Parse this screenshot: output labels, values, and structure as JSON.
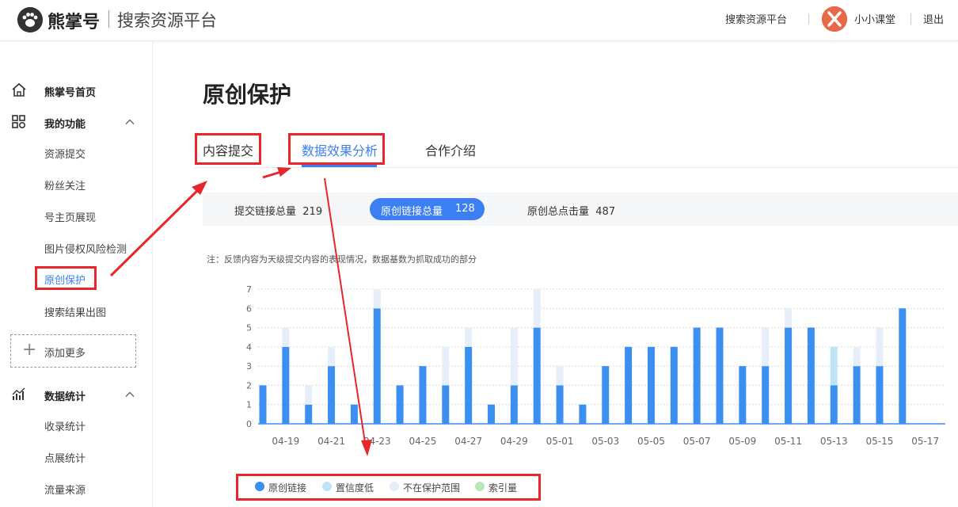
{
  "header": {
    "brand": "熊掌号",
    "subtitle": "搜索资源平台",
    "links": {
      "platform": "搜索资源平台",
      "username": "小小课堂",
      "logout": "退出"
    },
    "logo_icon": "paw-icon",
    "avatar_icon": "avatar-x-icon"
  },
  "sidebar": {
    "home": "熊掌号首页",
    "functions": {
      "title": "我的功能",
      "items": [
        "资源提交",
        "粉丝关注",
        "号主页展现",
        "图片侵权风险检测",
        "原创保护",
        "搜索结果出图"
      ]
    },
    "add_more": "添加更多",
    "stats": {
      "title": "数据统计",
      "items": [
        "收录统计",
        "点展统计",
        "流量来源"
      ]
    }
  },
  "main": {
    "title": "原创保护",
    "tabs": [
      "内容提交",
      "数据效果分析",
      "合作介绍"
    ],
    "active_tab": 1,
    "stats": [
      {
        "label": "提交链接总量",
        "value": "219"
      },
      {
        "label": "原创链接总量",
        "value": "128"
      },
      {
        "label": "原创总点击量",
        "value": "487"
      }
    ],
    "note": "注：反馈内容为天级提交内容的表现情况，数据基数为抓取成功的部分"
  },
  "chart_data": {
    "type": "bar",
    "stacked": true,
    "ylim": [
      0,
      7
    ],
    "yticks": [
      "0",
      "1",
      "2",
      "3",
      "4",
      "5",
      "6",
      "7"
    ],
    "xtick_labels": [
      "04-19",
      "04-21",
      "04-23",
      "04-25",
      "04-27",
      "04-29",
      "05-01",
      "05-03",
      "05-05",
      "05-07",
      "05-09",
      "05-11",
      "05-13",
      "05-15",
      "05-17"
    ],
    "categories": [
      "04-18",
      "04-19",
      "04-20",
      "04-21",
      "04-22",
      "04-23",
      "04-24",
      "04-25",
      "04-26",
      "04-27",
      "04-28",
      "04-29",
      "04-30",
      "05-01",
      "05-02",
      "05-03",
      "05-04",
      "05-05",
      "05-06",
      "05-07",
      "05-08",
      "05-09",
      "05-10",
      "05-11",
      "05-12",
      "05-13",
      "05-14",
      "05-15",
      "05-16"
    ],
    "series": [
      {
        "name": "原创链接",
        "color": "#3b8ff0",
        "values": [
          2,
          4,
          1,
          3,
          1,
          6,
          2,
          3,
          2,
          4,
          1,
          2,
          5,
          2,
          1,
          3,
          4,
          4,
          4,
          5,
          5,
          3,
          3,
          5,
          5,
          2,
          3,
          3,
          6
        ]
      },
      {
        "name": "置信度低",
        "color": "#bfe3f7",
        "values": [
          0,
          0,
          0,
          0,
          0,
          0,
          0,
          0,
          0,
          0,
          0,
          0,
          0,
          0,
          0,
          0,
          0,
          0,
          0,
          0,
          0,
          0,
          0,
          0,
          0,
          2,
          0,
          0,
          0
        ]
      },
      {
        "name": "不在保护范围",
        "color": "#e6eef9",
        "values": [
          0,
          1,
          1,
          1,
          0,
          1,
          0,
          0,
          2,
          1,
          0,
          3,
          2,
          1,
          0,
          0,
          0,
          0,
          0,
          0,
          0,
          0,
          2,
          1,
          0,
          0,
          1,
          2,
          0
        ]
      },
      {
        "name": "索引量",
        "color": "#b7e8b8",
        "values": [
          0,
          0,
          0,
          0,
          0,
          0,
          0,
          0,
          0,
          0,
          0,
          0,
          0,
          0,
          0,
          0,
          0,
          0,
          0,
          0,
          0,
          0,
          0,
          0,
          0,
          0,
          0,
          0,
          0
        ]
      }
    ],
    "grid": true,
    "legend_position": "bottom-left"
  }
}
